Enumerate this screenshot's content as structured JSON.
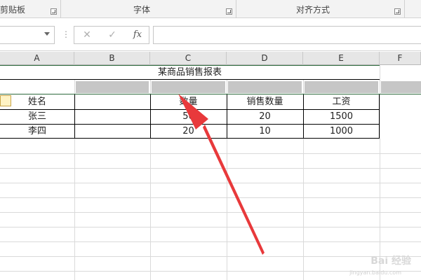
{
  "ribbon": {
    "groups": [
      {
        "label": "剪贴板"
      },
      {
        "label": "字体"
      },
      {
        "label": "对齐方式"
      }
    ]
  },
  "formula_bar": {
    "name_box_value": "",
    "cancel_icon": "close-icon",
    "enter_icon": "check-icon",
    "fx_label": "fx",
    "formula_value": ""
  },
  "columns": [
    "A",
    "B",
    "C",
    "D",
    "E",
    "F"
  ],
  "sheet": {
    "title": "某商品销售报表",
    "header": [
      "姓名",
      "",
      "数量",
      "销售数量",
      "工资"
    ],
    "rows": [
      [
        "张三",
        "",
        "50",
        "20",
        "1500"
      ],
      [
        "李四",
        "",
        "20",
        "10",
        "1000"
      ]
    ]
  },
  "colors": {
    "selection_border": "#2e6b3e",
    "selection_fill": "#c6c6c6",
    "arrow": "#e8393b"
  }
}
